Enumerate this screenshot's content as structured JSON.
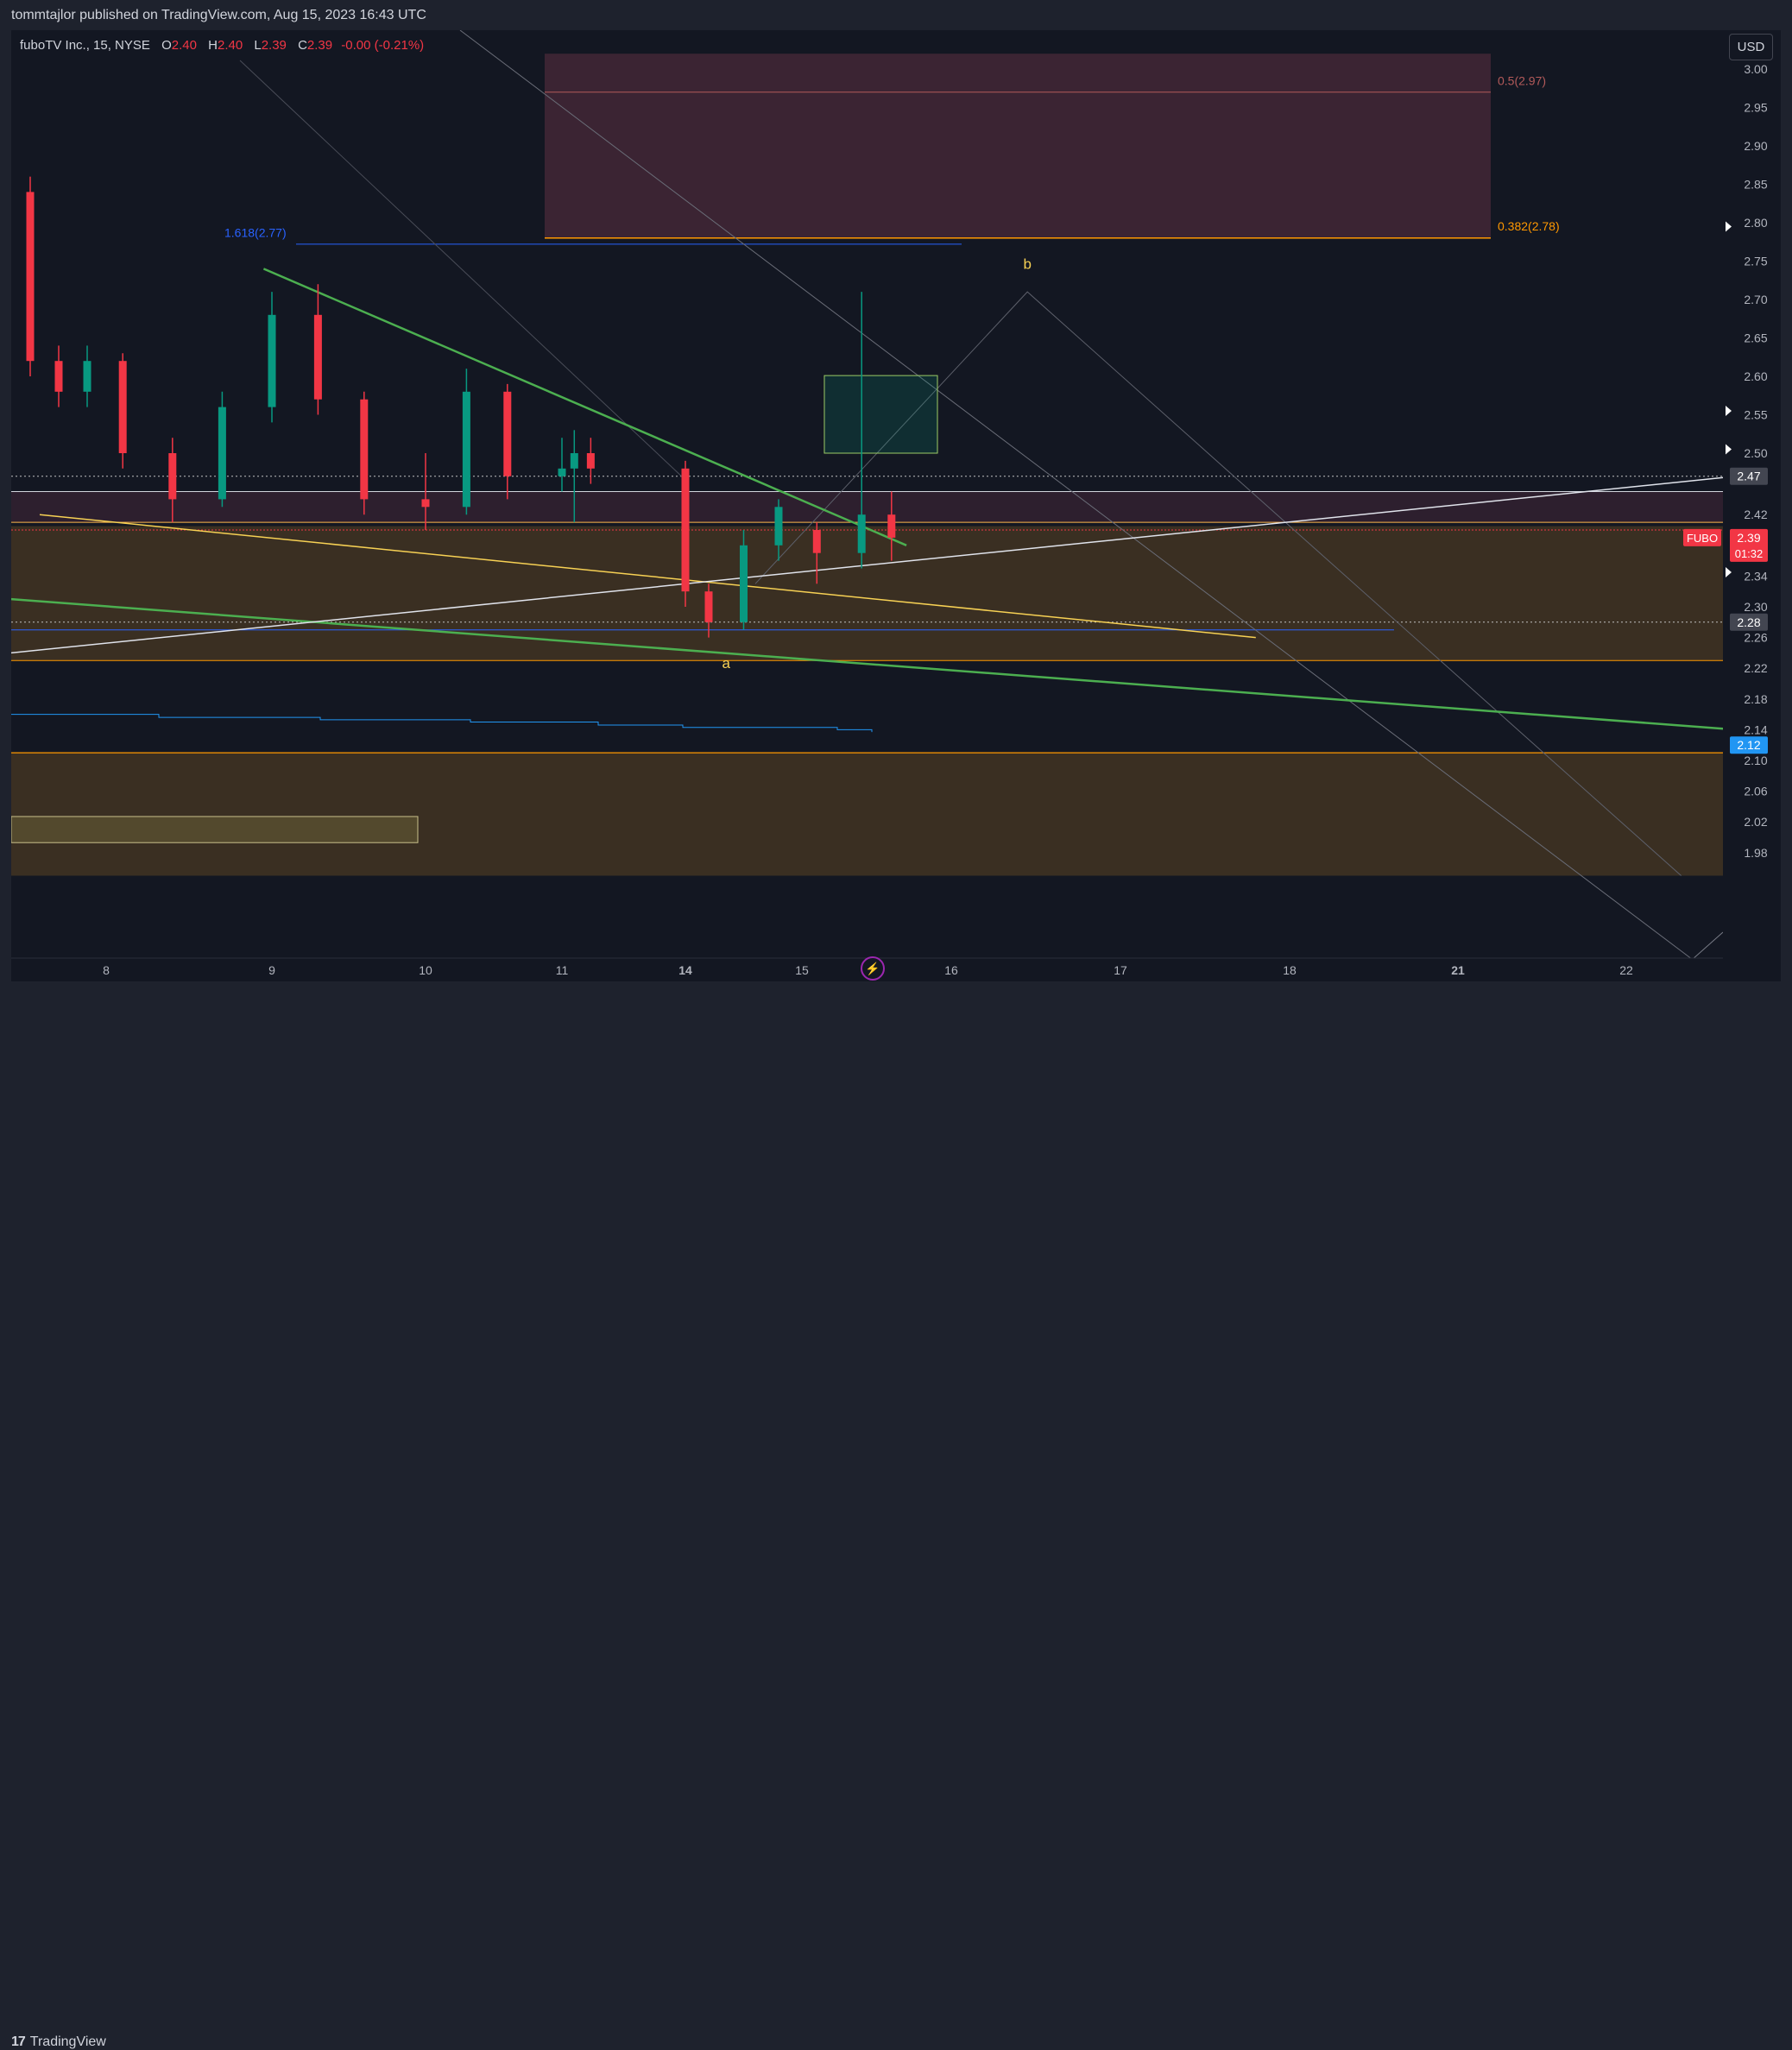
{
  "header": {
    "publisher_line": "tommtajlor published on TradingView.com, Aug 15, 2023 16:43 UTC"
  },
  "legend": {
    "symbol": "fuboTV Inc., 15, NYSE",
    "open_label": "O",
    "open": "2.40",
    "high_label": "H",
    "high": "2.40",
    "low_label": "L",
    "low": "2.39",
    "close_label": "C",
    "close": "2.39",
    "change": "-0.00 (-0.21%)"
  },
  "currency_button": "USD",
  "footer": {
    "brand": "TradingView",
    "logo_mark": "17"
  },
  "icons": {
    "replay": "lightning-icon"
  },
  "colors": {
    "background": "#131722",
    "up": "#089981",
    "down": "#f23645",
    "fib_zone": "#3b2433",
    "demand_zone": "#3a2f22",
    "trendline_green": "#4caf50",
    "trendline_yellow": "#f7d154",
    "trendline_white": "#e0e3eb",
    "fib_ext": "#2962ff"
  },
  "chart_data": {
    "type": "candlestick",
    "symbol": "FUBO",
    "interval": "15",
    "y_axis": {
      "range": [
        1.95,
        3.02
      ],
      "ticks": [
        3.0,
        2.95,
        2.9,
        2.85,
        2.8,
        2.75,
        2.7,
        2.65,
        2.6,
        2.55,
        2.5,
        2.42,
        2.34,
        2.3,
        2.26,
        2.22,
        2.18,
        2.14,
        2.1,
        2.06,
        2.02,
        1.98
      ],
      "tick_labels": [
        "3.00",
        "2.95",
        "2.90",
        "2.85",
        "2.80",
        "2.75",
        "2.70",
        "2.65",
        "2.60",
        "2.55",
        "2.50",
        "2.42",
        "2.34",
        "2.30",
        "2.26",
        "2.22",
        "2.18",
        "2.14",
        "2.10",
        "2.06",
        "2.02",
        "1.98"
      ],
      "price_tags": [
        {
          "label": "2.47",
          "value": 2.47,
          "color": "#434651"
        },
        {
          "label": "2.28",
          "value": 2.28,
          "color": "#434651"
        },
        {
          "label": "2.12",
          "value": 2.12,
          "color": "#2196f3"
        }
      ],
      "last_price": {
        "symbol": "FUBO",
        "label": "2.39",
        "countdown": "01:32",
        "value": 2.39,
        "color": "#f23645"
      }
    },
    "x_axis": {
      "ticks": [
        8,
        9,
        10,
        11,
        14,
        15,
        16,
        17,
        18,
        21,
        22
      ],
      "tick_labels": [
        "8",
        "9",
        "10",
        "11",
        "14",
        "15",
        "16",
        "17",
        "18",
        "21",
        "22"
      ]
    },
    "candles_ohlc_approx": [
      {
        "t": 7.2,
        "o": 2.84,
        "h": 2.86,
        "l": 2.6,
        "c": 2.62
      },
      {
        "t": 7.5,
        "o": 2.62,
        "h": 2.64,
        "l": 2.56,
        "c": 2.58
      },
      {
        "t": 7.8,
        "o": 2.58,
        "h": 2.64,
        "l": 2.56,
        "c": 2.62
      },
      {
        "t": 8.1,
        "o": 2.62,
        "h": 2.63,
        "l": 2.48,
        "c": 2.5
      },
      {
        "t": 8.4,
        "o": 2.5,
        "h": 2.52,
        "l": 2.41,
        "c": 2.44
      },
      {
        "t": 8.7,
        "o": 2.44,
        "h": 2.58,
        "l": 2.43,
        "c": 2.56
      },
      {
        "t": 9.0,
        "o": 2.56,
        "h": 2.71,
        "l": 2.54,
        "c": 2.68
      },
      {
        "t": 9.3,
        "o": 2.68,
        "h": 2.72,
        "l": 2.55,
        "c": 2.57
      },
      {
        "t": 9.6,
        "o": 2.57,
        "h": 2.58,
        "l": 2.42,
        "c": 2.44
      },
      {
        "t": 10.0,
        "o": 2.44,
        "h": 2.5,
        "l": 2.4,
        "c": 2.43
      },
      {
        "t": 10.3,
        "o": 2.43,
        "h": 2.61,
        "l": 2.42,
        "c": 2.58
      },
      {
        "t": 10.6,
        "o": 2.58,
        "h": 2.59,
        "l": 2.44,
        "c": 2.47
      },
      {
        "t": 11.0,
        "o": 2.47,
        "h": 2.52,
        "l": 2.45,
        "c": 2.48
      },
      {
        "t": 11.3,
        "o": 2.48,
        "h": 2.53,
        "l": 2.41,
        "c": 2.5
      },
      {
        "t": 11.7,
        "o": 2.5,
        "h": 2.52,
        "l": 2.46,
        "c": 2.48
      },
      {
        "t": 14.0,
        "o": 2.48,
        "h": 2.49,
        "l": 2.3,
        "c": 2.32
      },
      {
        "t": 14.2,
        "o": 2.32,
        "h": 2.33,
        "l": 2.26,
        "c": 2.28
      },
      {
        "t": 14.5,
        "o": 2.28,
        "h": 2.4,
        "l": 2.27,
        "c": 2.38
      },
      {
        "t": 14.8,
        "o": 2.38,
        "h": 2.44,
        "l": 2.36,
        "c": 2.43
      },
      {
        "t": 15.1,
        "o": 2.4,
        "h": 2.41,
        "l": 2.33,
        "c": 2.37
      },
      {
        "t": 15.4,
        "o": 2.37,
        "h": 2.71,
        "l": 2.35,
        "c": 2.42
      },
      {
        "t": 15.6,
        "o": 2.42,
        "h": 2.45,
        "l": 2.36,
        "c": 2.39
      }
    ],
    "fib_retracement": [
      {
        "label": "0.5(2.97)",
        "value": 2.97
      },
      {
        "label": "0.382(2.78)",
        "value": 2.78
      }
    ],
    "fib_extension": {
      "label": "1.618(2.77)",
      "value": 2.77
    },
    "wave_labels": [
      {
        "label": "a",
        "t": 14.35,
        "price": 2.22
      },
      {
        "label": "b",
        "t": 16.45,
        "price": 2.74
      }
    ],
    "zones": [
      {
        "name": "fib-zone",
        "top": 3.02,
        "bottom": 2.78
      },
      {
        "name": "supply-band",
        "top": 2.45,
        "bottom": 2.41
      },
      {
        "name": "demand-zone-upper",
        "top": 2.405,
        "bottom": 2.23
      },
      {
        "name": "demand-zone-lower",
        "top": 2.11,
        "bottom": 1.95
      }
    ],
    "horizontal_levels": [
      2.47,
      2.45,
      2.41,
      2.4,
      2.28,
      2.27,
      2.23,
      2.11
    ],
    "trendlines": [
      {
        "name": "green-upper",
        "from": [
          8.95,
          2.74
        ],
        "to": [
          15.7,
          2.38
        ]
      },
      {
        "name": "green-lower",
        "from": [
          7.0,
          2.31
        ],
        "to": [
          22.8,
          2.14
        ]
      },
      {
        "name": "yellow",
        "from": [
          7.3,
          2.42
        ],
        "to": [
          17.8,
          2.26
        ]
      },
      {
        "name": "white",
        "from": [
          7.0,
          2.24
        ],
        "to": [
          22.8,
          2.47
        ]
      }
    ],
    "grid": false,
    "legend_position": "top-left"
  }
}
